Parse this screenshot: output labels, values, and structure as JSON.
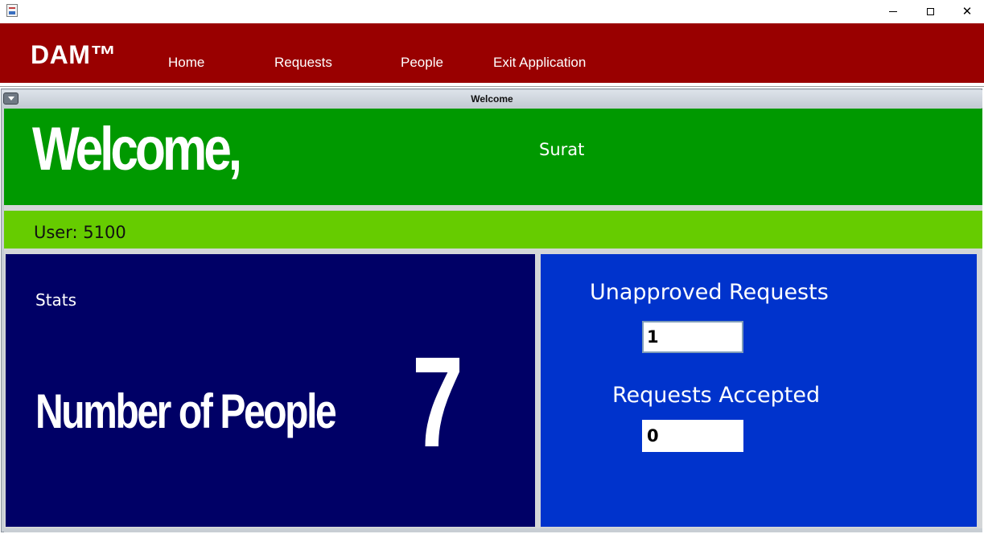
{
  "window": {
    "close_glyph": "✕"
  },
  "menubar": {
    "brand": "DAM™",
    "items": [
      {
        "label": "Home"
      },
      {
        "label": "Requests"
      },
      {
        "label": "People"
      },
      {
        "label": "Exit Application"
      }
    ],
    "background": "#990000"
  },
  "internal_frame": {
    "title": "Welcome"
  },
  "welcome": {
    "heading": "Welcome,",
    "name": "Surat",
    "background": "#009900"
  },
  "user": {
    "label": "User: 5100",
    "background": "#66cc00"
  },
  "stats": {
    "label": "Stats",
    "people_label": "Number of People",
    "people_count": "7",
    "background": "#000066"
  },
  "requests": {
    "unapproved_label": "Unapproved Requests",
    "unapproved_value": "1",
    "accepted_label": "Requests Accepted",
    "accepted_value": "0",
    "background": "#0033cc"
  }
}
